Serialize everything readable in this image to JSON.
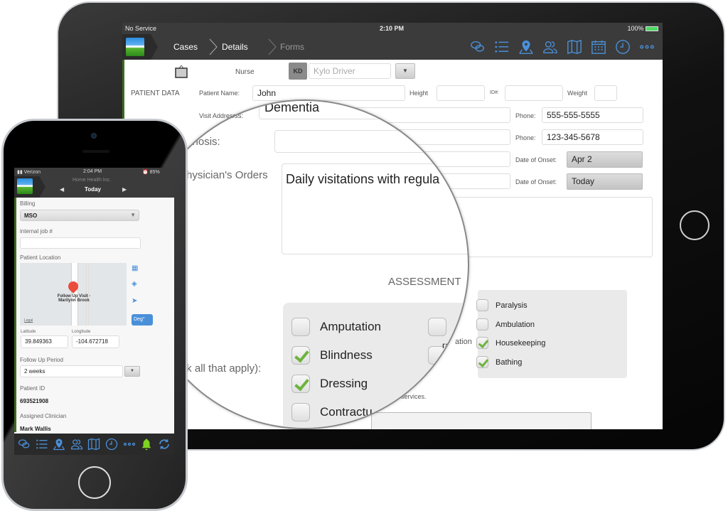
{
  "tablet": {
    "status_bar": {
      "carrier": "No Service",
      "time": "2:10 PM",
      "battery": "100%"
    },
    "nav": {
      "breadcrumbs": [
        {
          "label": "Cases",
          "active": true
        },
        {
          "label": "Details",
          "active": true
        },
        {
          "label": "Forms",
          "active": false
        }
      ],
      "icons": [
        "chat-icon",
        "list-icon",
        "map-pin-icon",
        "people-icon",
        "map-icon",
        "calendar-icon",
        "clock-icon",
        "more-icon"
      ]
    },
    "form": {
      "nurse_label": "Nurse",
      "nurse_initials": "KD",
      "nurse_name": "Kylo Driver",
      "section_label": "PATIENT DATA",
      "patient_name_label": "Patient Name:",
      "patient_name": "John",
      "height_label": "Height",
      "id_label": "ID#:",
      "weight_label": "Weight",
      "visit_address_label": "Visit Address:",
      "phone_label": "Phone:",
      "phone1": "555-555-5555",
      "phone2": "123-345-5678",
      "date_of_onset_label": "Date of Onset:",
      "onset1": "Apr 2",
      "onset2": "Today",
      "services_text": "services."
    },
    "magnifier": {
      "diagnosis_value": "Dementia",
      "diagnosis_label": "y Diagnosis:",
      "physician_orders_label": "Physician's Orders",
      "physician_orders_value": "Daily visitations with regula",
      "assessment_title": "ASSESSMENT",
      "check_all_label": "heck all that apply):",
      "partial_label": "ration",
      "checkboxes": [
        {
          "label": "Amputation",
          "checked": false
        },
        {
          "label": "Blindness",
          "checked": true
        },
        {
          "label": "Dressing",
          "checked": true
        },
        {
          "label": "Contractu",
          "checked": false
        }
      ]
    },
    "assessment_right": [
      {
        "label": "Paralysis",
        "checked": false
      },
      {
        "label": "Ambulation",
        "checked": false
      },
      {
        "label": "Housekeeping",
        "checked": true
      },
      {
        "label": "Bathing",
        "checked": true
      }
    ],
    "partial_label": "ation"
  },
  "phone": {
    "status_bar": {
      "carrier": "Verizon",
      "time": "2:04 PM",
      "battery": "85%"
    },
    "nav": {
      "company": "Home Health Inc.",
      "date": "Today"
    },
    "billing_label": "Billing",
    "billing_value": "MSO",
    "job_label": "internal job #",
    "location_label": "Patient Location",
    "map_caption": "Follow Up Visit - Marilynn Brook",
    "map_legal": "Legal",
    "deg_button": "Deg°",
    "latitude_label": "Latitude",
    "latitude": "39.849363",
    "longitude_label": "Longitude",
    "longitude": "-104.672718",
    "follow_up_label": "Follow Up Period",
    "follow_up_value": "2 weeks",
    "patient_id_label": "Patient ID",
    "patient_id": "693521908",
    "clinician_label": "Assigned Clinician",
    "clinician": "Mark Wallis",
    "tab_icons": [
      "chat-icon",
      "list-icon",
      "map-pin-icon",
      "people-icon",
      "map-icon",
      "clock-icon",
      "more-icon",
      "bell-icon",
      "sync-icon"
    ],
    "alert_color": "#7ed321"
  },
  "colors": {
    "accent": "#4a90d9",
    "check": "#6db33f",
    "nav_bg": "#3b3b3b"
  }
}
